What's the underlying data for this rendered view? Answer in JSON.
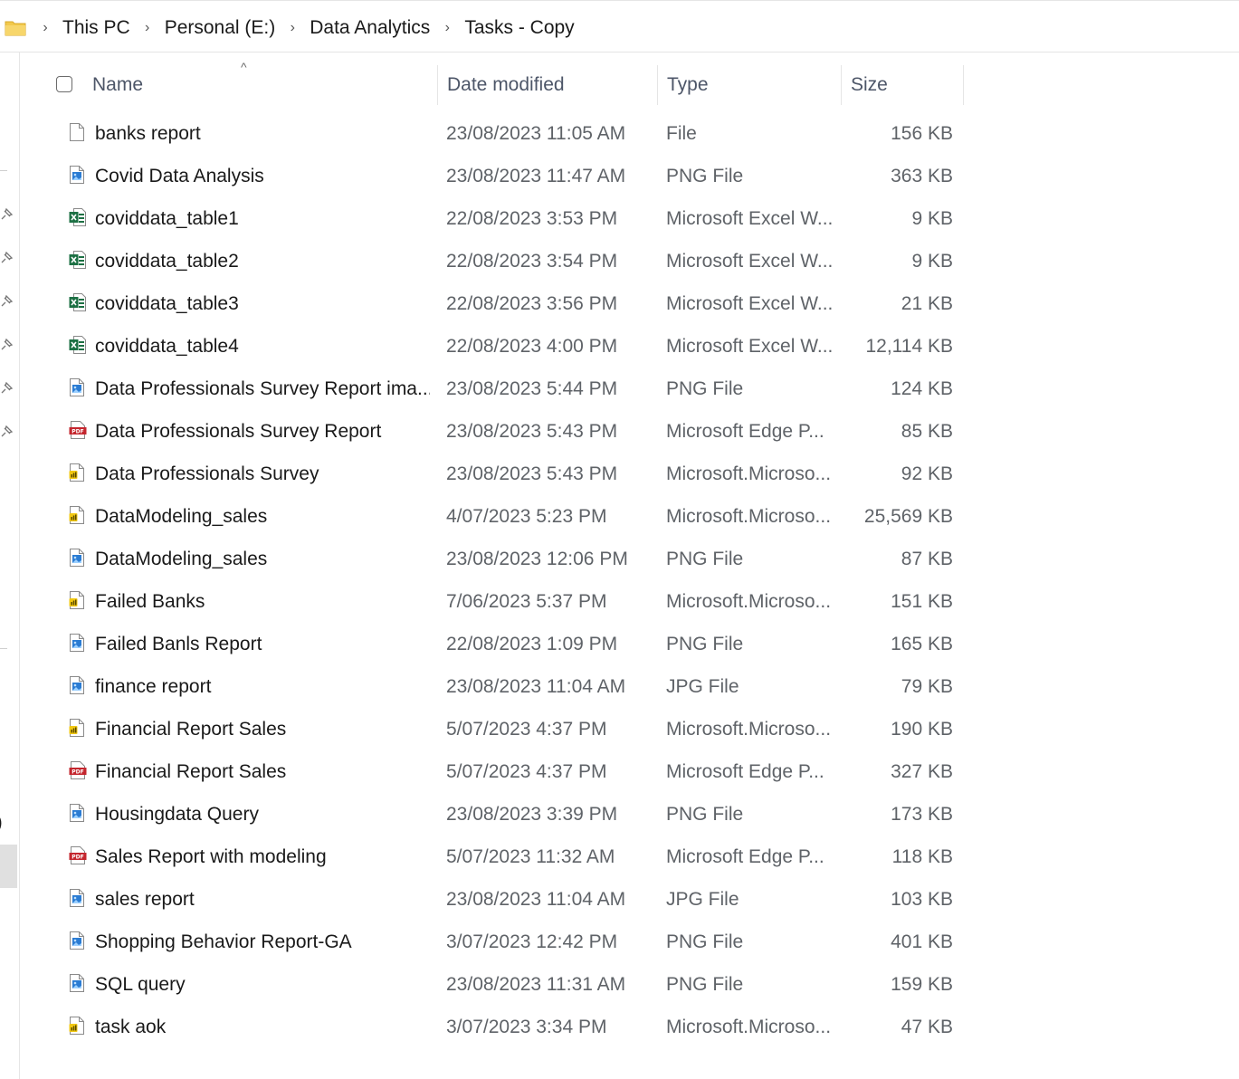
{
  "breadcrumb": {
    "items": [
      "This PC",
      "Personal (E:)",
      "Data Analytics",
      "Tasks - Copy"
    ],
    "separator": "›"
  },
  "header": {
    "name": "Name",
    "date_modified": "Date modified",
    "type": "Type",
    "size": "Size",
    "sort_indicator": "^"
  },
  "nav": {
    "partial_text": ")"
  },
  "files": [
    {
      "name": "banks report",
      "date": "23/08/2023 11:05 AM",
      "type": "File",
      "size": "156 KB",
      "icon": "file-icon"
    },
    {
      "name": "Covid Data Analysis",
      "date": "23/08/2023 11:47 AM",
      "type": "PNG File",
      "size": "363 KB",
      "icon": "image-file-icon"
    },
    {
      "name": "coviddata_table1",
      "date": "22/08/2023 3:53 PM",
      "type": "Microsoft Excel W...",
      "size": "9 KB",
      "icon": "excel-file-icon"
    },
    {
      "name": "coviddata_table2",
      "date": "22/08/2023 3:54 PM",
      "type": "Microsoft Excel W...",
      "size": "9 KB",
      "icon": "excel-file-icon"
    },
    {
      "name": "coviddata_table3",
      "date": "22/08/2023 3:56 PM",
      "type": "Microsoft Excel W...",
      "size": "21 KB",
      "icon": "excel-file-icon"
    },
    {
      "name": "coviddata_table4",
      "date": "22/08/2023 4:00 PM",
      "type": "Microsoft Excel W...",
      "size": "12,114 KB",
      "icon": "excel-file-icon"
    },
    {
      "name": "Data Professionals Survey Report ima...",
      "date": "23/08/2023 5:44 PM",
      "type": "PNG File",
      "size": "124 KB",
      "icon": "image-file-icon"
    },
    {
      "name": "Data Professionals Survey Report",
      "date": "23/08/2023 5:43 PM",
      "type": "Microsoft Edge P...",
      "size": "85 KB",
      "icon": "pdf-file-icon"
    },
    {
      "name": "Data Professionals Survey",
      "date": "23/08/2023 5:43 PM",
      "type": "Microsoft.Microso...",
      "size": "92 KB",
      "icon": "powerbi-file-icon"
    },
    {
      "name": "DataModeling_sales",
      "date": "4/07/2023 5:23 PM",
      "type": "Microsoft.Microso...",
      "size": "25,569 KB",
      "icon": "powerbi-file-icon"
    },
    {
      "name": "DataModeling_sales",
      "date": "23/08/2023 12:06 PM",
      "type": "PNG File",
      "size": "87 KB",
      "icon": "image-file-icon"
    },
    {
      "name": "Failed Banks",
      "date": "7/06/2023 5:37 PM",
      "type": "Microsoft.Microso...",
      "size": "151 KB",
      "icon": "powerbi-file-icon"
    },
    {
      "name": "Failed Banls Report",
      "date": "22/08/2023 1:09 PM",
      "type": "PNG File",
      "size": "165 KB",
      "icon": "image-file-icon"
    },
    {
      "name": "finance report",
      "date": "23/08/2023 11:04 AM",
      "type": "JPG File",
      "size": "79 KB",
      "icon": "image-file-icon"
    },
    {
      "name": "Financial Report Sales",
      "date": "5/07/2023 4:37 PM",
      "type": "Microsoft.Microso...",
      "size": "190 KB",
      "icon": "powerbi-file-icon"
    },
    {
      "name": "Financial Report Sales",
      "date": "5/07/2023 4:37 PM",
      "type": "Microsoft Edge P...",
      "size": "327 KB",
      "icon": "pdf-file-icon"
    },
    {
      "name": "Housingdata Query",
      "date": "23/08/2023 3:39 PM",
      "type": "PNG File",
      "size": "173 KB",
      "icon": "image-file-icon"
    },
    {
      "name": "Sales Report with modeling",
      "date": "5/07/2023 11:32 AM",
      "type": "Microsoft Edge P...",
      "size": "118 KB",
      "icon": "pdf-file-icon"
    },
    {
      "name": "sales report",
      "date": "23/08/2023 11:04 AM",
      "type": "JPG File",
      "size": "103 KB",
      "icon": "image-file-icon"
    },
    {
      "name": "Shopping Behavior Report-GA",
      "date": "3/07/2023 12:42 PM",
      "type": "PNG File",
      "size": "401 KB",
      "icon": "image-file-icon"
    },
    {
      "name": "SQL query",
      "date": "23/08/2023 11:31 AM",
      "type": "PNG File",
      "size": "159 KB",
      "icon": "image-file-icon"
    },
    {
      "name": "task aok",
      "date": "3/07/2023 3:34 PM",
      "type": "Microsoft.Microso...",
      "size": "47 KB",
      "icon": "powerbi-file-icon"
    }
  ],
  "colors": {
    "folder": "#f2c94c",
    "excel": "#1d7044",
    "pdf": "#c4262e",
    "powerbi": "#f2c811",
    "image": "#2b7cd3",
    "header_text": "#4d5668",
    "meta_text": "#5f6368"
  }
}
